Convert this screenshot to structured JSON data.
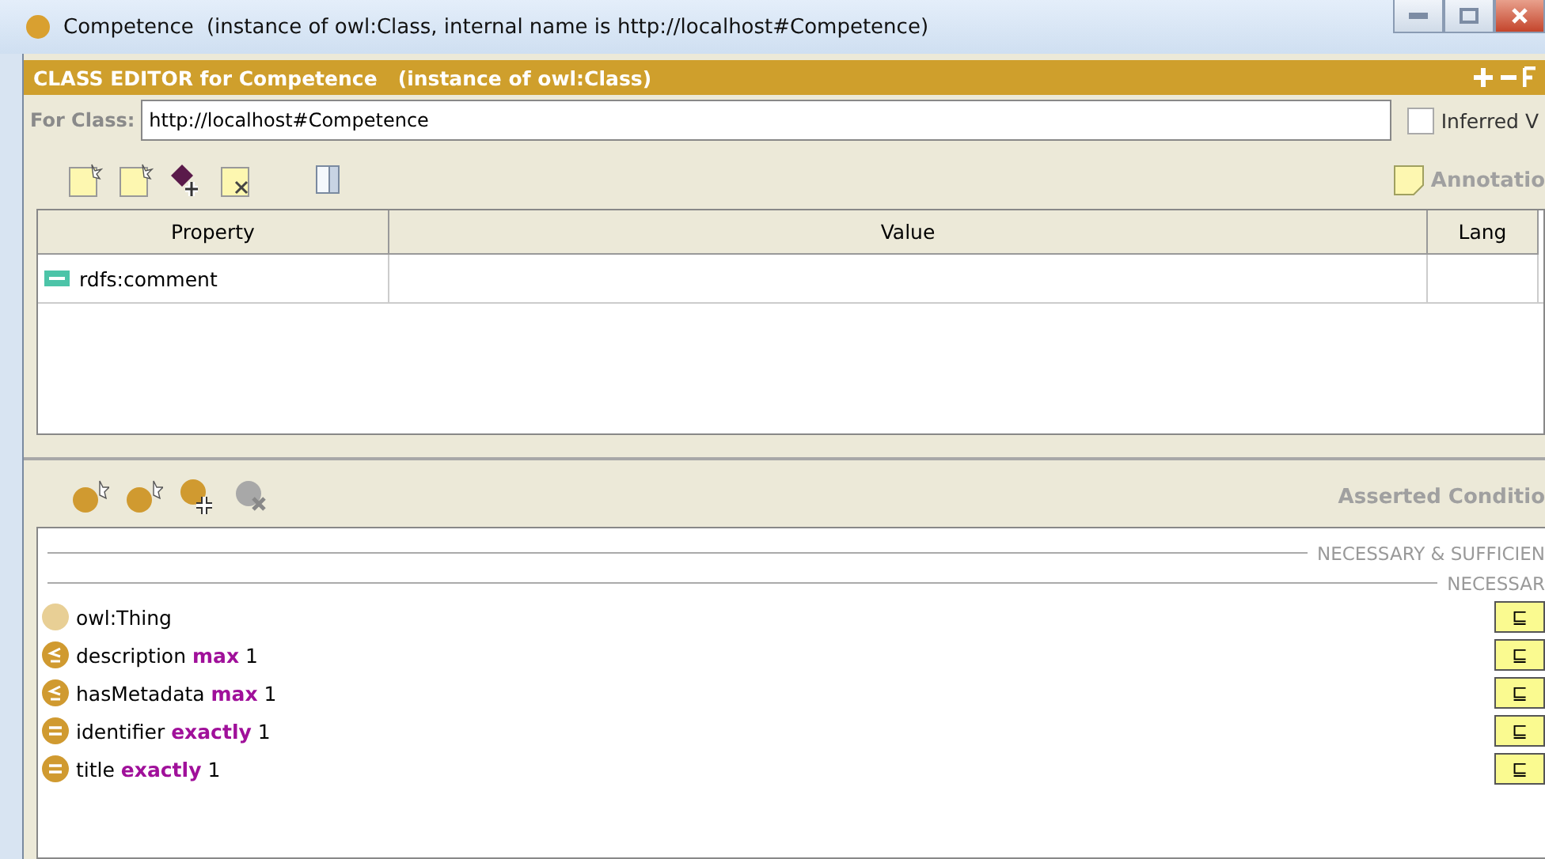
{
  "window": {
    "title": "Competence",
    "subtitle": "(instance of owl:Class, internal name is http://localhost#Competence)"
  },
  "editor": {
    "title": "CLASS EDITOR for Competence",
    "subtitle": "(instance of owl:Class)",
    "for_class_label": "For Class:",
    "for_class_value": "http://localhost#Competence",
    "inferred": {
      "label": "Inferred V",
      "checked": false
    }
  },
  "annotations": {
    "label": "Annotatio",
    "columns": [
      "Property",
      "Value",
      "Lang"
    ],
    "rows": [
      {
        "property": "rdfs:comment",
        "value": "",
        "lang": ""
      }
    ]
  },
  "conditions": {
    "label": "Asserted Conditio",
    "sections": [
      "NECESSARY & SUFFICIEN",
      "NECESSAR"
    ],
    "rows": [
      {
        "kind": "named",
        "text": "owl:Thing",
        "badge": "⊑"
      },
      {
        "kind": "max",
        "text": "description **max** 1",
        "badge": "⊑"
      },
      {
        "kind": "max",
        "text": "hasMetadata **max** 1",
        "badge": "⊑"
      },
      {
        "kind": "exactly",
        "text": "identifier **exactly** 1",
        "badge": "⊑"
      },
      {
        "kind": "exactly",
        "text": "title **exactly** 1",
        "badge": "⊑"
      }
    ]
  }
}
